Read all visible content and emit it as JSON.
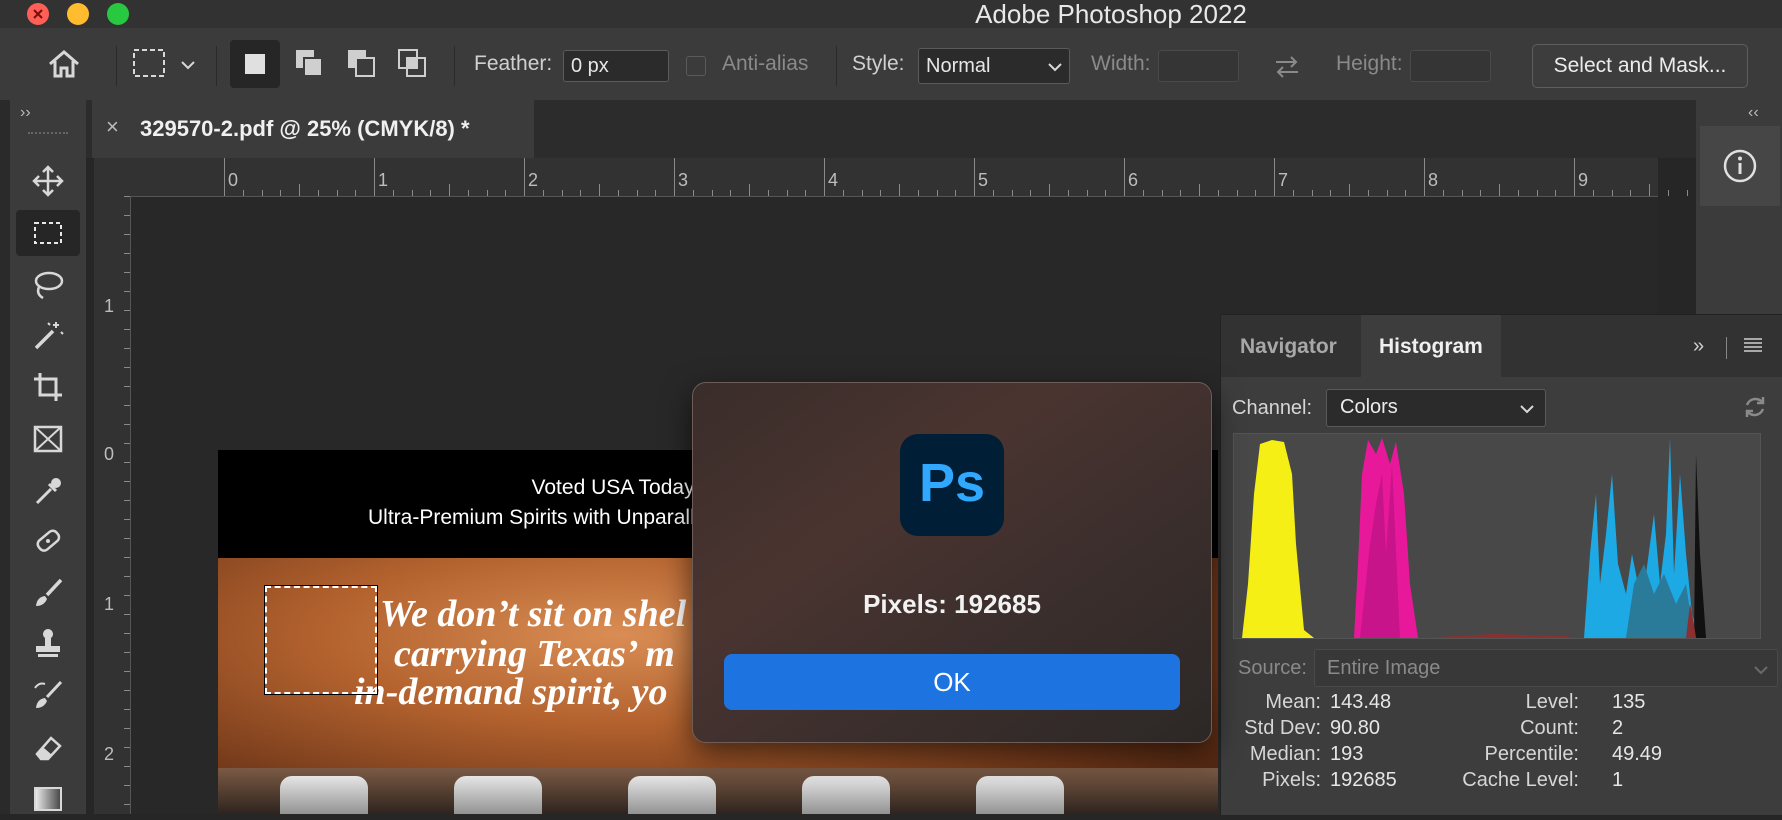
{
  "app": {
    "title": "Adobe Photoshop 2022"
  },
  "options": {
    "feather_label": "Feather:",
    "feather_value": "0 px",
    "antialias_label": "Anti-alias",
    "style_label": "Style:",
    "style_value": "Normal",
    "width_label": "Width:",
    "height_label": "Height:",
    "select_mask_label": "Select and Mask..."
  },
  "document": {
    "tab_title": "329570-2.pdf @ 25% (CMYK/8) *",
    "close_symbol": "×",
    "header_line1": "Voted USA Today Best",
    "header_line2": "Ultra-Premium Spirits with Unparallel",
    "headline_line1": "We don’t sit on shel",
    "headline_line2": "carrying Texas’ m",
    "headline_line3": "in-demand spirit, yo"
  },
  "rulers": {
    "h": [
      "0",
      "1",
      "2",
      "3",
      "4",
      "5",
      "6",
      "7",
      "8",
      "9"
    ],
    "v": [
      "1",
      "0",
      "1",
      "2"
    ]
  },
  "dialog": {
    "logo_text": "Ps",
    "message": "Pixels: 192685",
    "ok_label": "OK"
  },
  "histogram": {
    "tabs": [
      "Navigator",
      "Histogram"
    ],
    "active_tab": "Histogram",
    "channel_label": "Channel:",
    "channel_value": "Colors",
    "source_label": "Source:",
    "source_value": "Entire Image",
    "stats_left": [
      {
        "label": "Mean:",
        "value": "143.48"
      },
      {
        "label": "Std Dev:",
        "value": "90.80"
      },
      {
        "label": "Median:",
        "value": "193"
      },
      {
        "label": "Pixels:",
        "value": "192685"
      }
    ],
    "stats_right": [
      {
        "label": "Level:",
        "value": "135"
      },
      {
        "label": "Count:",
        "value": "2"
      },
      {
        "label": "Percentile:",
        "value": "49.49"
      },
      {
        "label": "Cache Level:",
        "value": "1"
      }
    ],
    "colors": {
      "yellow": "#f5ef16",
      "magenta": "#e8189a",
      "cyan": "#1ca9e4"
    }
  },
  "colors": {
    "accent_button": "#1d74e0",
    "ps_logo_bg": "#001e36",
    "ps_logo_fg": "#31a8ff"
  }
}
